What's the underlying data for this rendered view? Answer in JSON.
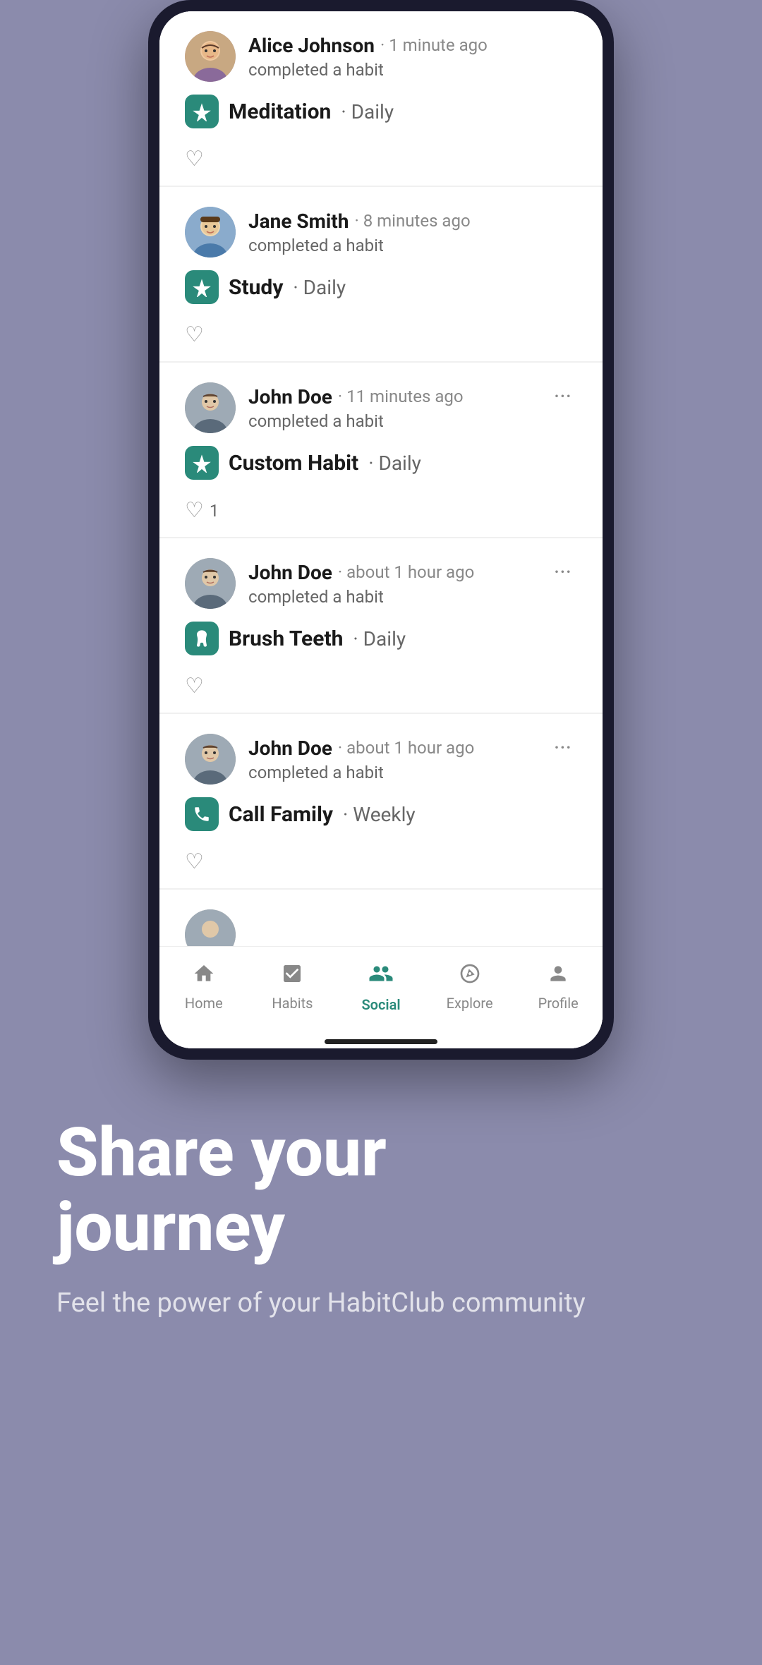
{
  "background_color": "#8b8bac",
  "phone": {
    "feed_items": [
      {
        "id": "item-1",
        "user": "Alice Johnson",
        "avatar_type": "alice",
        "avatar_emoji": "👩",
        "time": "· 1 minute ago",
        "action": "completed a habit",
        "habit_name": "Meditation",
        "habit_freq": "· Daily",
        "habit_icon": "⭐",
        "likes": 0,
        "show_more": false,
        "show_likes_count": false
      },
      {
        "id": "item-2",
        "user": "Jane Smith",
        "avatar_type": "jane",
        "avatar_emoji": "👨",
        "time": "· 8 minutes ago",
        "action": "completed a habit",
        "habit_name": "Study",
        "habit_freq": "· Daily",
        "habit_icon": "⭐",
        "likes": 0,
        "show_more": false,
        "show_likes_count": false
      },
      {
        "id": "item-3",
        "user": "John Doe",
        "avatar_type": "john",
        "avatar_emoji": "👨",
        "time": "· 11 minutes ago",
        "action": "completed a habit",
        "habit_name": "Custom Habit",
        "habit_freq": "· Daily",
        "habit_icon": "⭐",
        "likes": 1,
        "show_more": true,
        "show_likes_count": true
      },
      {
        "id": "item-4",
        "user": "John Doe",
        "avatar_type": "john",
        "avatar_emoji": "👨",
        "time": "· about 1 hour ago",
        "action": "completed a habit",
        "habit_name": "Brush Teeth",
        "habit_freq": "· Daily",
        "habit_icon": "🦷",
        "likes": 0,
        "show_more": true,
        "show_likes_count": false
      },
      {
        "id": "item-5",
        "user": "John Doe",
        "avatar_type": "john",
        "avatar_emoji": "👨",
        "time": "· about 1 hour ago",
        "action": "completed a habit",
        "habit_name": "Call Family",
        "habit_freq": "· Weekly",
        "habit_icon": "📞",
        "likes": 0,
        "show_more": true,
        "show_likes_count": false
      }
    ],
    "nav_items": [
      {
        "id": "home",
        "label": "Home",
        "icon": "🏠",
        "active": false
      },
      {
        "id": "habits",
        "label": "Habits",
        "icon": "☑",
        "active": false
      },
      {
        "id": "social",
        "label": "Social",
        "icon": "👥",
        "active": true
      },
      {
        "id": "explore",
        "label": "Explore",
        "icon": "🧭",
        "active": false
      },
      {
        "id": "profile",
        "label": "Profile",
        "icon": "👤",
        "active": false
      }
    ]
  },
  "bottom": {
    "headline_line1": "Share your",
    "headline_line2": "journey",
    "subtext": "Feel the power of your HabitClub community"
  }
}
